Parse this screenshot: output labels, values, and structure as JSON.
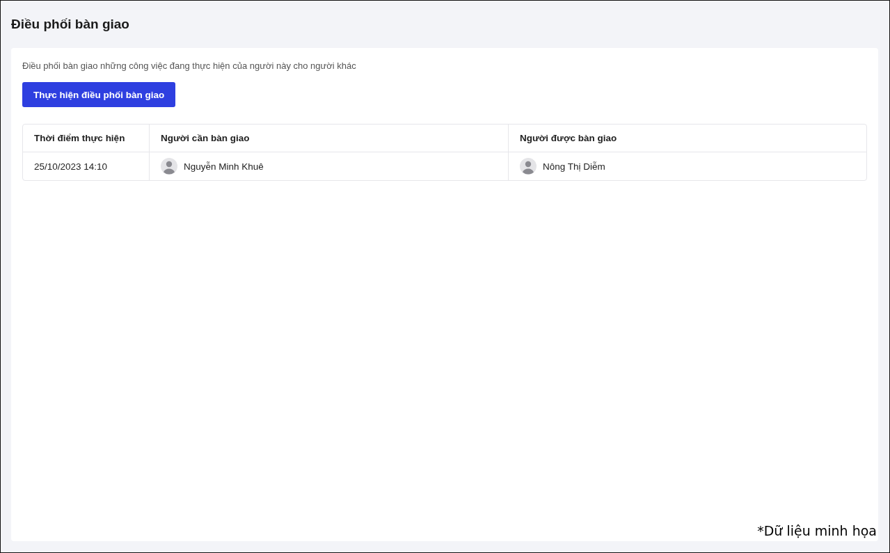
{
  "page": {
    "title": "Điều phối bàn giao"
  },
  "description": "Điều phối bàn giao những công việc đang thực hiện của người này cho người khác",
  "action_button": "Thực hiện điều phối bàn giao",
  "table": {
    "columns": [
      "Thời điểm thực hiện",
      "Người cần bàn giao",
      "Người được bàn giao"
    ],
    "rows": [
      {
        "time": "25/10/2023 14:10",
        "from": "Nguyễn Minh Khuê",
        "to": "Nông Thị Diễm"
      }
    ]
  },
  "note": "*Dữ liệu minh họa"
}
